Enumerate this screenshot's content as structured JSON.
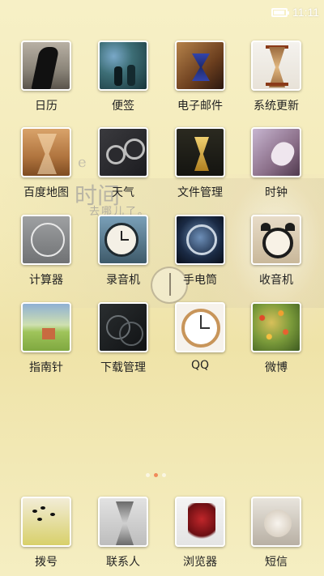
{
  "status_bar": {
    "time": "11:11",
    "battery_level": 0.9
  },
  "wallpaper": {
    "text_small": "e",
    "text_large": "时间",
    "text_sub": "去哪儿了。"
  },
  "apps": [
    {
      "label": "日历",
      "icon": "calendar-icon"
    },
    {
      "label": "便签",
      "icon": "notes-icon"
    },
    {
      "label": "电子邮件",
      "icon": "email-icon"
    },
    {
      "label": "系统更新",
      "icon": "system-update-icon"
    },
    {
      "label": "百度地图",
      "icon": "baidu-maps-icon"
    },
    {
      "label": "天气",
      "icon": "weather-icon"
    },
    {
      "label": "文件管理",
      "icon": "file-manager-icon"
    },
    {
      "label": "时钟",
      "icon": "clock-icon"
    },
    {
      "label": "计算器",
      "icon": "calculator-icon"
    },
    {
      "label": "录音机",
      "icon": "recorder-icon"
    },
    {
      "label": "手电筒",
      "icon": "flashlight-icon"
    },
    {
      "label": "收音机",
      "icon": "radio-icon"
    },
    {
      "label": "指南针",
      "icon": "compass-icon"
    },
    {
      "label": "下载管理",
      "icon": "download-manager-icon"
    },
    {
      "label": "QQ",
      "icon": "qq-icon"
    },
    {
      "label": "微博",
      "icon": "weibo-icon"
    }
  ],
  "page_indicator": {
    "count": 3,
    "active": 1
  },
  "dock": [
    {
      "label": "拨号",
      "icon": "phone-icon"
    },
    {
      "label": "联系人",
      "icon": "contacts-icon"
    },
    {
      "label": "浏览器",
      "icon": "browser-icon"
    },
    {
      "label": "短信",
      "icon": "sms-icon"
    }
  ]
}
